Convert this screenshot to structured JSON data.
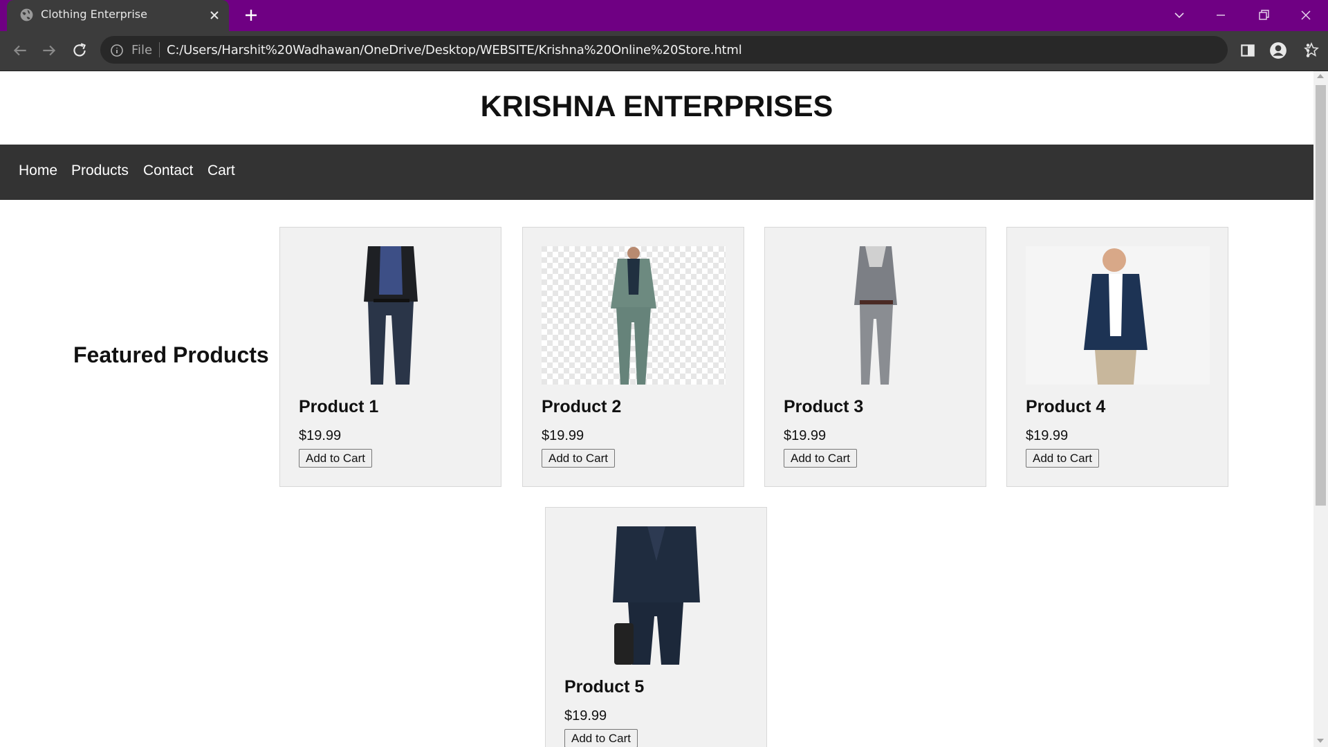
{
  "browser": {
    "tab_title": "Clothing Enterprise",
    "address_scheme": "File",
    "address_url": "C:/Users/Harshit%20Wadhawan/OneDrive/Desktop/WEBSITE/Krishna%20Online%20Store.html"
  },
  "site": {
    "title": "KRISHNA ENTERPRISES",
    "nav": [
      {
        "label": "Home"
      },
      {
        "label": "Products"
      },
      {
        "label": "Contact"
      },
      {
        "label": "Cart"
      }
    ],
    "featured_heading": "Featured Products",
    "products": [
      {
        "name": "Product 1",
        "price": "$19.99",
        "button": "Add to Cart",
        "image": "man-leather-jacket-jeans"
      },
      {
        "name": "Product 2",
        "price": "$19.99",
        "button": "Add to Cart",
        "image": "man-sage-green-suit"
      },
      {
        "name": "Product 3",
        "price": "$19.99",
        "button": "Add to Cart",
        "image": "man-grey-cardigan-scarf"
      },
      {
        "name": "Product 4",
        "price": "$19.99",
        "button": "Add to Cart",
        "image": "man-navy-blazer"
      },
      {
        "name": "Product 5",
        "price": "$19.99",
        "button": "Add to Cart",
        "image": "man-pinstripe-suit-briefcase"
      }
    ]
  },
  "colors": {
    "tabbar": "#6f0083",
    "toolbar": "#3c3c3c",
    "site_nav": "#333333",
    "card_bg": "#f1f1f1"
  }
}
